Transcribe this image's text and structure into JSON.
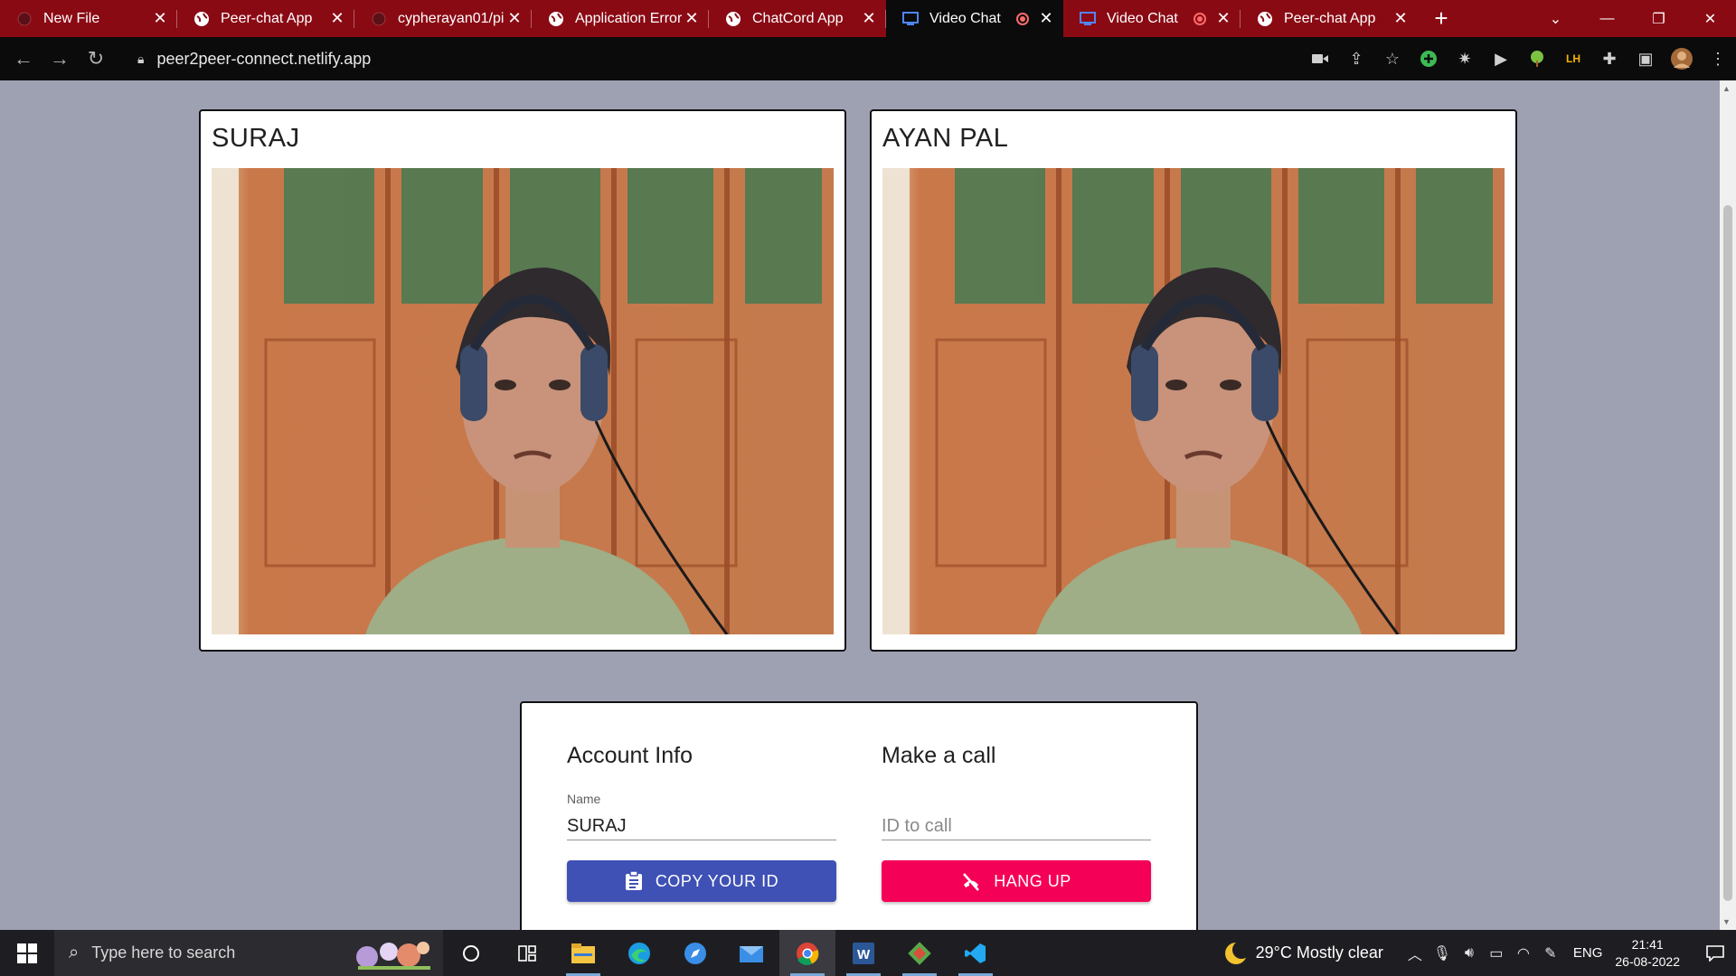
{
  "browser": {
    "tabs": [
      {
        "title": "New File",
        "icon": "github-icon",
        "active": false,
        "recording": false
      },
      {
        "title": "Peer-chat App",
        "icon": "globe-icon",
        "active": false,
        "recording": false
      },
      {
        "title": "cypherayan01/pi",
        "icon": "github-icon",
        "active": false,
        "recording": false
      },
      {
        "title": "Application Error",
        "icon": "globe-icon",
        "active": false,
        "recording": false
      },
      {
        "title": "ChatCord App",
        "icon": "globe-icon",
        "active": false,
        "recording": false
      },
      {
        "title": "Video Chat",
        "icon": "video-chat-icon",
        "active": true,
        "recording": true
      },
      {
        "title": "Video Chat",
        "icon": "video-chat-icon",
        "active": false,
        "recording": true
      },
      {
        "title": "Peer-chat App",
        "icon": "globe-icon",
        "active": false,
        "recording": false
      }
    ],
    "url": "peer2peer-connect.netlify.app",
    "tab_strip_color": "#8a0a14"
  },
  "page": {
    "videos": {
      "left": {
        "name": "SURAJ"
      },
      "right": {
        "name": "AYAN PAL"
      }
    },
    "account": {
      "heading": "Account Info",
      "name_label": "Name",
      "name_value": "SURAJ",
      "copy_button": "COPY YOUR ID"
    },
    "call": {
      "heading": "Make a call",
      "id_placeholder": "ID to call",
      "hangup_button": "HANG UP"
    },
    "colors": {
      "background": "#9ea1b2",
      "primary": "#3f51b5",
      "secondary": "#f50057"
    }
  },
  "taskbar": {
    "search_placeholder": "Type here to search",
    "weather": "29°C  Mostly clear",
    "language": "ENG",
    "time": "21:41",
    "date": "26-08-2022",
    "apps": [
      "task-view-icon",
      "file-explorer-icon",
      "edge-icon",
      "safari-icon",
      "mail-icon",
      "chrome-icon",
      "word-icon",
      "git-icon",
      "vscode-icon"
    ]
  }
}
